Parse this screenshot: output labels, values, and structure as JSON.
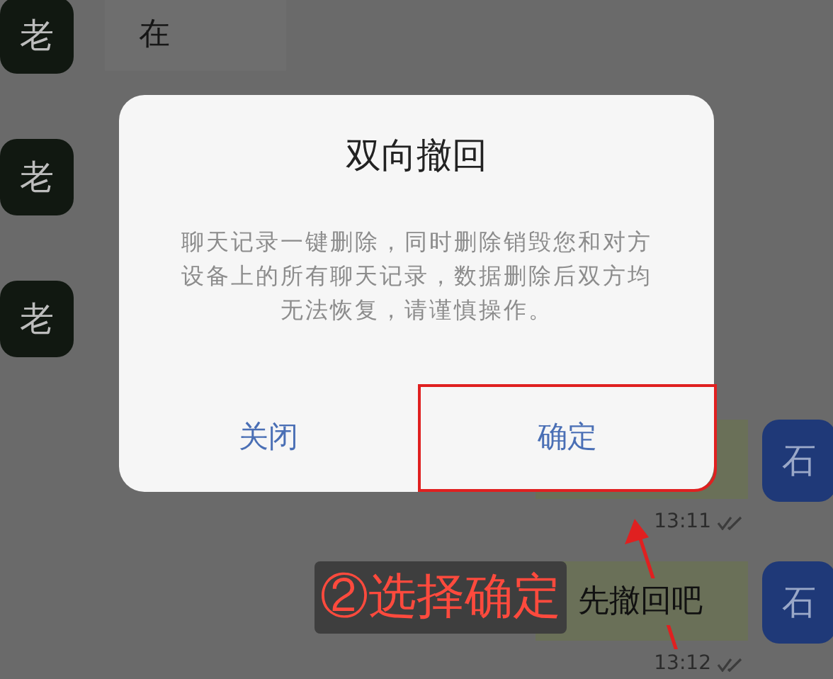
{
  "chat": {
    "messages": [
      {
        "kind": "received",
        "avatar": "老",
        "text": "在"
      },
      {
        "kind": "received",
        "avatar": "老"
      },
      {
        "kind": "received",
        "avatar": "老"
      },
      {
        "kind": "sent",
        "avatar": "石",
        "time": "13:11",
        "read": true
      },
      {
        "kind": "sent",
        "avatar": "石",
        "text": "先撤回吧",
        "time": "13:12",
        "read": true
      }
    ]
  },
  "dialog": {
    "title": "双向撤回",
    "message": "聊天记录一键删除，同时删除销毁您和对方设备上的所有聊天记录，数据删除后双方均无法恢复，请谨慎操作。",
    "buttons": [
      {
        "label": "关闭",
        "highlighted": false
      },
      {
        "label": "确定",
        "highlighted": true
      }
    ]
  },
  "annotation": {
    "text": "②选择确定"
  }
}
